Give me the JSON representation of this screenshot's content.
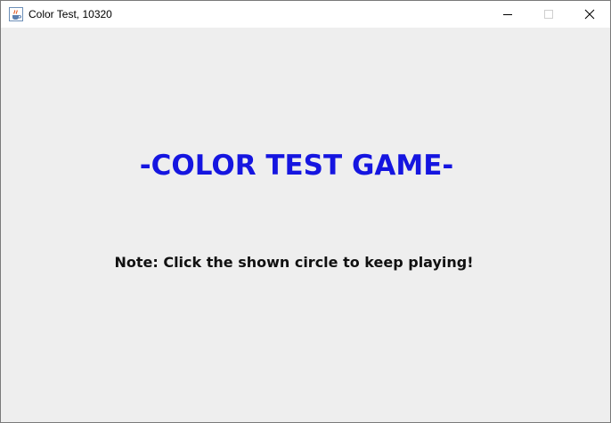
{
  "window": {
    "title": "Color Test, 10320",
    "app_icon": "java-cup-icon",
    "controls": {
      "minimize_icon": "minimize-icon",
      "maximize_icon": "maximize-icon",
      "close_icon": "close-icon"
    }
  },
  "game": {
    "title": "-COLOR TEST GAME-",
    "note": "Note: Click the shown circle to keep playing!"
  },
  "colors": {
    "title_text": "#1515e0",
    "note_text": "#111111",
    "background": "#eeeeee",
    "titlebar": "#ffffff"
  }
}
